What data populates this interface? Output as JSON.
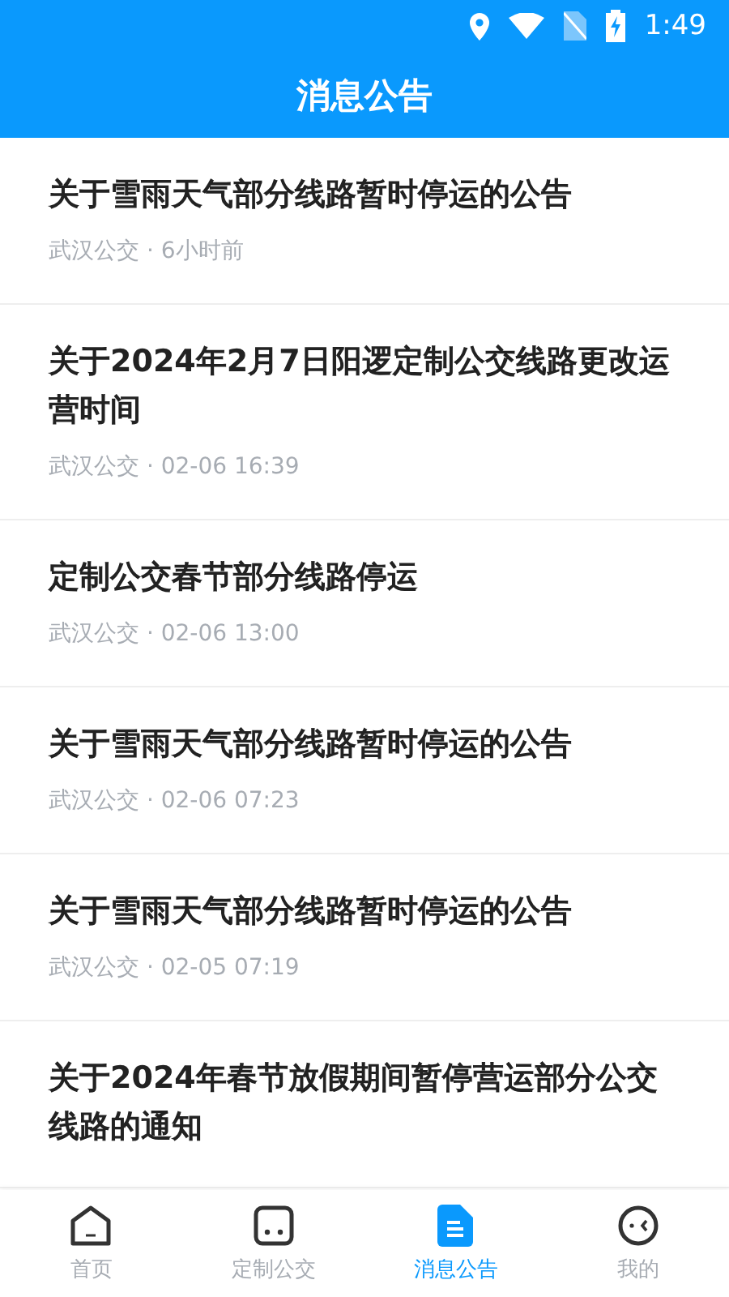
{
  "status_bar": {
    "time": "1:49"
  },
  "header": {
    "title": "消息公告"
  },
  "notices": [
    {
      "title": "关于雪雨天气部分线路暂时停运的公告",
      "meta": "武汉公交 · 6小时前"
    },
    {
      "title": "关于2024年2月7日阳逻定制公交线路更改运营时间",
      "meta": "武汉公交 · 02-06 16:39"
    },
    {
      "title": "定制公交春节部分线路停运",
      "meta": "武汉公交 · 02-06 13:00"
    },
    {
      "title": "关于雪雨天气部分线路暂时停运的公告",
      "meta": "武汉公交 · 02-06 07:23"
    },
    {
      "title": "关于雪雨天气部分线路暂时停运的公告",
      "meta": "武汉公交 · 02-05 07:19"
    },
    {
      "title": "关于2024年春节放假期间暂停营运部分公交线路的通知"
    }
  ],
  "tabs": [
    {
      "kind": "home",
      "label": "首页",
      "selected": false
    },
    {
      "kind": "bus",
      "label": "定制公交",
      "selected": false
    },
    {
      "kind": "doc",
      "label": "消息公告",
      "selected": true
    },
    {
      "kind": "face",
      "label": "我的",
      "selected": false
    }
  ]
}
